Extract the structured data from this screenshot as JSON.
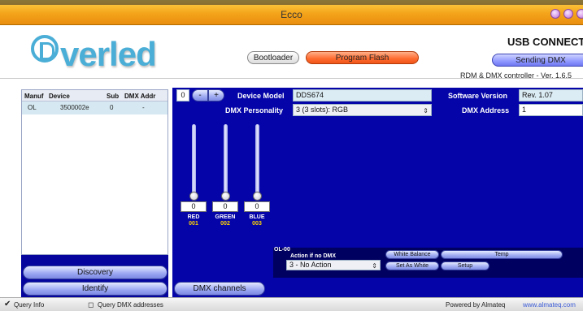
{
  "window": {
    "title": "Ecco",
    "colors": {
      "titlebar": "#f4a41a",
      "main_panel": "#0404a8",
      "program_flash": "#ff6a2e"
    }
  },
  "header": {
    "logo_text": "verled",
    "bootloader_label": "Bootloader",
    "program_flash_label": "Program Flash",
    "usb_status": "USB CONNECTED",
    "sending_dmx_label": "Sending DMX",
    "version_text": "RDM & DMX controller - Ver. 1.6.5"
  },
  "device_list": {
    "columns": [
      "Manuf",
      "Device",
      "Sub",
      "DMX Addr"
    ],
    "rows": [
      {
        "manuf": "OL",
        "device": "3500002e",
        "sub": "0",
        "dmx_addr": "-"
      }
    ],
    "discovery_label": "Discovery",
    "identify_label": "Identify"
  },
  "device": {
    "index": "0",
    "minus_label": "-",
    "plus_label": "+",
    "model_label": "Device Model",
    "model_value": "DDS674",
    "personality_label": "DMX Personality",
    "personality_value": "3 (3 slots): RGB",
    "software_label": "Software Version",
    "software_value": "Rev. 1.07",
    "address_label": "DMX Address",
    "address_value": "1"
  },
  "channels": [
    {
      "name": "RED",
      "number": "001",
      "value": "0"
    },
    {
      "name": "GREEN",
      "number": "002",
      "value": "0"
    },
    {
      "name": "BLUE",
      "number": "003",
      "value": "0"
    }
  ],
  "no_dmx": {
    "id_label": "OL-00",
    "action_label": "Action if no DMX",
    "action_value": "3 - No Action",
    "white_balance_label": "White Balance",
    "temp_label": "Temp",
    "set_as_white_label": "Set As White",
    "setup_label": "Setup"
  },
  "dmx_channels_label": "DMX channels",
  "status_bar": {
    "query_info_label": "Query Info",
    "query_info_checked": true,
    "query_dmx_label": "Query DMX addresses",
    "query_dmx_checked": false,
    "powered_by": "Powered by Almateq",
    "url": "www.almateq.com"
  }
}
